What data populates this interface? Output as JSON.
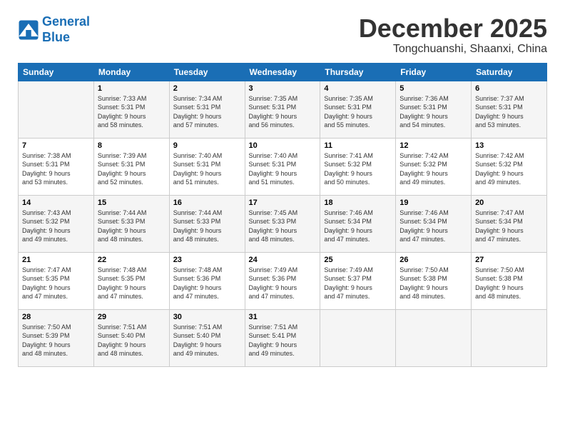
{
  "header": {
    "logo_line1": "General",
    "logo_line2": "Blue",
    "month": "December 2025",
    "location": "Tongchuanshi, Shaanxi, China"
  },
  "weekdays": [
    "Sunday",
    "Monday",
    "Tuesday",
    "Wednesday",
    "Thursday",
    "Friday",
    "Saturday"
  ],
  "weeks": [
    [
      {
        "day": "",
        "info": ""
      },
      {
        "day": "1",
        "info": "Sunrise: 7:33 AM\nSunset: 5:31 PM\nDaylight: 9 hours\nand 58 minutes."
      },
      {
        "day": "2",
        "info": "Sunrise: 7:34 AM\nSunset: 5:31 PM\nDaylight: 9 hours\nand 57 minutes."
      },
      {
        "day": "3",
        "info": "Sunrise: 7:35 AM\nSunset: 5:31 PM\nDaylight: 9 hours\nand 56 minutes."
      },
      {
        "day": "4",
        "info": "Sunrise: 7:35 AM\nSunset: 5:31 PM\nDaylight: 9 hours\nand 55 minutes."
      },
      {
        "day": "5",
        "info": "Sunrise: 7:36 AM\nSunset: 5:31 PM\nDaylight: 9 hours\nand 54 minutes."
      },
      {
        "day": "6",
        "info": "Sunrise: 7:37 AM\nSunset: 5:31 PM\nDaylight: 9 hours\nand 53 minutes."
      }
    ],
    [
      {
        "day": "7",
        "info": "Sunrise: 7:38 AM\nSunset: 5:31 PM\nDaylight: 9 hours\nand 53 minutes."
      },
      {
        "day": "8",
        "info": "Sunrise: 7:39 AM\nSunset: 5:31 PM\nDaylight: 9 hours\nand 52 minutes."
      },
      {
        "day": "9",
        "info": "Sunrise: 7:40 AM\nSunset: 5:31 PM\nDaylight: 9 hours\nand 51 minutes."
      },
      {
        "day": "10",
        "info": "Sunrise: 7:40 AM\nSunset: 5:31 PM\nDaylight: 9 hours\nand 51 minutes."
      },
      {
        "day": "11",
        "info": "Sunrise: 7:41 AM\nSunset: 5:32 PM\nDaylight: 9 hours\nand 50 minutes."
      },
      {
        "day": "12",
        "info": "Sunrise: 7:42 AM\nSunset: 5:32 PM\nDaylight: 9 hours\nand 49 minutes."
      },
      {
        "day": "13",
        "info": "Sunrise: 7:42 AM\nSunset: 5:32 PM\nDaylight: 9 hours\nand 49 minutes."
      }
    ],
    [
      {
        "day": "14",
        "info": "Sunrise: 7:43 AM\nSunset: 5:32 PM\nDaylight: 9 hours\nand 49 minutes."
      },
      {
        "day": "15",
        "info": "Sunrise: 7:44 AM\nSunset: 5:33 PM\nDaylight: 9 hours\nand 48 minutes."
      },
      {
        "day": "16",
        "info": "Sunrise: 7:44 AM\nSunset: 5:33 PM\nDaylight: 9 hours\nand 48 minutes."
      },
      {
        "day": "17",
        "info": "Sunrise: 7:45 AM\nSunset: 5:33 PM\nDaylight: 9 hours\nand 48 minutes."
      },
      {
        "day": "18",
        "info": "Sunrise: 7:46 AM\nSunset: 5:34 PM\nDaylight: 9 hours\nand 47 minutes."
      },
      {
        "day": "19",
        "info": "Sunrise: 7:46 AM\nSunset: 5:34 PM\nDaylight: 9 hours\nand 47 minutes."
      },
      {
        "day": "20",
        "info": "Sunrise: 7:47 AM\nSunset: 5:34 PM\nDaylight: 9 hours\nand 47 minutes."
      }
    ],
    [
      {
        "day": "21",
        "info": "Sunrise: 7:47 AM\nSunset: 5:35 PM\nDaylight: 9 hours\nand 47 minutes."
      },
      {
        "day": "22",
        "info": "Sunrise: 7:48 AM\nSunset: 5:35 PM\nDaylight: 9 hours\nand 47 minutes."
      },
      {
        "day": "23",
        "info": "Sunrise: 7:48 AM\nSunset: 5:36 PM\nDaylight: 9 hours\nand 47 minutes."
      },
      {
        "day": "24",
        "info": "Sunrise: 7:49 AM\nSunset: 5:36 PM\nDaylight: 9 hours\nand 47 minutes."
      },
      {
        "day": "25",
        "info": "Sunrise: 7:49 AM\nSunset: 5:37 PM\nDaylight: 9 hours\nand 47 minutes."
      },
      {
        "day": "26",
        "info": "Sunrise: 7:50 AM\nSunset: 5:38 PM\nDaylight: 9 hours\nand 48 minutes."
      },
      {
        "day": "27",
        "info": "Sunrise: 7:50 AM\nSunset: 5:38 PM\nDaylight: 9 hours\nand 48 minutes."
      }
    ],
    [
      {
        "day": "28",
        "info": "Sunrise: 7:50 AM\nSunset: 5:39 PM\nDaylight: 9 hours\nand 48 minutes."
      },
      {
        "day": "29",
        "info": "Sunrise: 7:51 AM\nSunset: 5:40 PM\nDaylight: 9 hours\nand 48 minutes."
      },
      {
        "day": "30",
        "info": "Sunrise: 7:51 AM\nSunset: 5:40 PM\nDaylight: 9 hours\nand 49 minutes."
      },
      {
        "day": "31",
        "info": "Sunrise: 7:51 AM\nSunset: 5:41 PM\nDaylight: 9 hours\nand 49 minutes."
      },
      {
        "day": "",
        "info": ""
      },
      {
        "day": "",
        "info": ""
      },
      {
        "day": "",
        "info": ""
      }
    ]
  ]
}
